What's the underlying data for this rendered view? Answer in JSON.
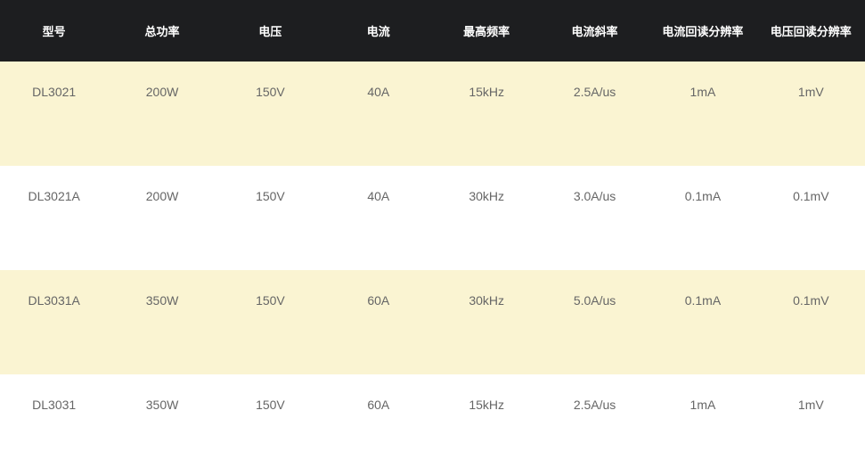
{
  "table": {
    "headers": [
      "型号",
      "总功率",
      "电压",
      "电流",
      "最高频率",
      "电流斜率",
      "电流回读分辨率",
      "电压回读分辨率"
    ],
    "rows": [
      [
        "DL3021",
        "200W",
        "150V",
        "40A",
        "15kHz",
        "2.5A/us",
        "1mA",
        "1mV"
      ],
      [
        "DL3021A",
        "200W",
        "150V",
        "40A",
        "30kHz",
        "3.0A/us",
        "0.1mA",
        "0.1mV"
      ],
      [
        "DL3031A",
        "350W",
        "150V",
        "60A",
        "30kHz",
        "5.0A/us",
        "0.1mA",
        "0.1mV"
      ],
      [
        "DL3031",
        "350W",
        "150V",
        "60A",
        "15kHz",
        "2.5A/us",
        "1mA",
        "1mV"
      ]
    ]
  },
  "colors": {
    "header_bg": "#1d1e20",
    "header_text": "#ffffff",
    "row_odd_bg": "#faf4d2",
    "row_even_bg": "#ffffff",
    "cell_text": "#666666"
  }
}
